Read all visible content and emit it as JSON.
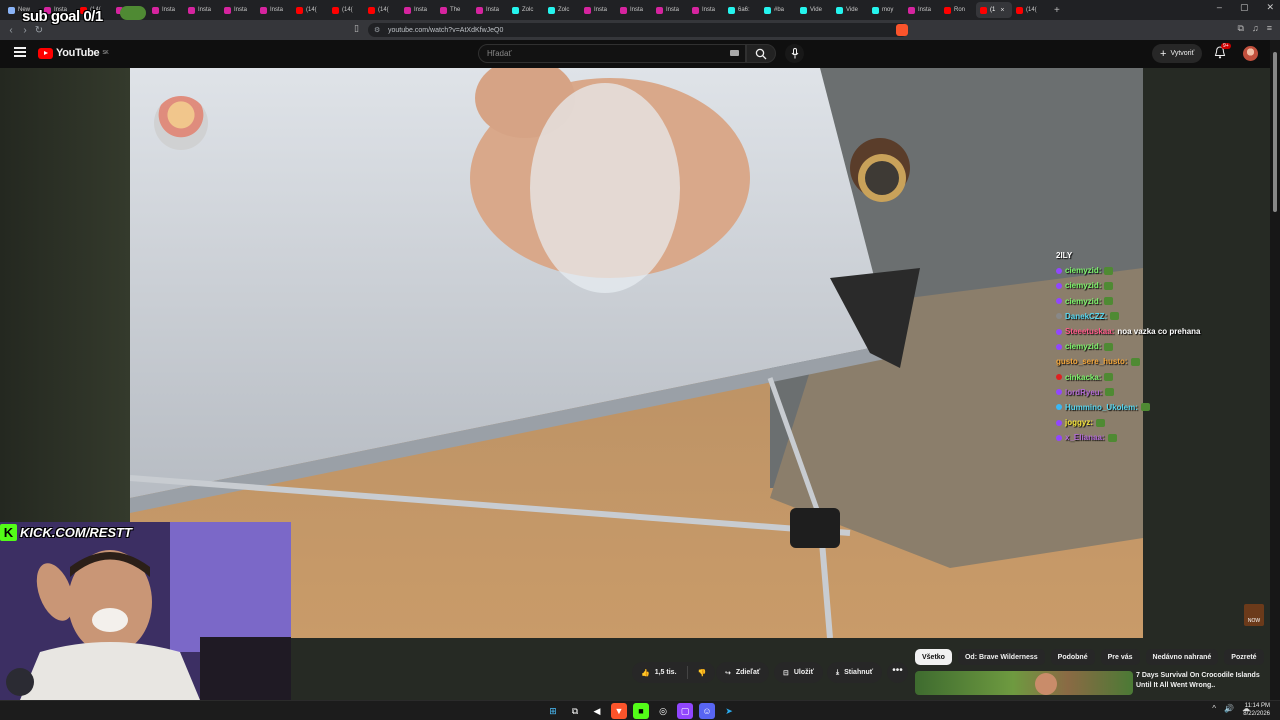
{
  "browser": {
    "tabs": [
      {
        "label": "New",
        "color": "#8ab4f8"
      },
      {
        "label": "Insta",
        "color": "#d6249f"
      },
      {
        "label": "(14(",
        "color": "#ff0000"
      },
      {
        "label": "Insta",
        "color": "#d6249f"
      },
      {
        "label": "Insta",
        "color": "#d6249f"
      },
      {
        "label": "Insta",
        "color": "#d6249f"
      },
      {
        "label": "Insta",
        "color": "#d6249f"
      },
      {
        "label": "Insta",
        "color": "#d6249f"
      },
      {
        "label": "(14(",
        "color": "#ff0000"
      },
      {
        "label": "(14(",
        "color": "#ff0000"
      },
      {
        "label": "(14(",
        "color": "#ff0000"
      },
      {
        "label": "Insta",
        "color": "#d6249f"
      },
      {
        "label": "The",
        "color": "#d6249f"
      },
      {
        "label": "Insta",
        "color": "#d6249f"
      },
      {
        "label": "Zolc",
        "color": "#25f4ee"
      },
      {
        "label": "Zolc",
        "color": "#25f4ee"
      },
      {
        "label": "Insta",
        "color": "#d6249f"
      },
      {
        "label": "Insta",
        "color": "#d6249f"
      },
      {
        "label": "Insta",
        "color": "#d6249f"
      },
      {
        "label": "Insta",
        "color": "#d6249f"
      },
      {
        "label": "6a6:",
        "color": "#25f4ee"
      },
      {
        "label": "#ba",
        "color": "#25f4ee"
      },
      {
        "label": "Vide",
        "color": "#25f4ee"
      },
      {
        "label": "Vide",
        "color": "#25f4ee"
      },
      {
        "label": "moy",
        "color": "#25f4ee"
      },
      {
        "label": "Insta",
        "color": "#d6249f"
      },
      {
        "label": "Ron",
        "color": "#ff0000"
      },
      {
        "label": "(1",
        "color": "#ff0000",
        "active": true
      },
      {
        "label": "(14(",
        "color": "#ff0000"
      }
    ],
    "new_tab_label": "+",
    "window_controls": [
      "–",
      "▢",
      "✕"
    ],
    "url": "youtube.com/watch?v=AtXdKfwJeQ0"
  },
  "youtube": {
    "logo_text": "YouTube",
    "region": "SK",
    "search_placeholder": "Hľadať",
    "create_label": "Vytvoriť",
    "notification_count": "9+",
    "actions": {
      "likes": "1,5 tis.",
      "share": "Zdieľať",
      "save": "Uložiť",
      "download": "Stiahnuť",
      "more": "•••"
    },
    "chips": [
      {
        "label": "Všetko",
        "active": true
      },
      {
        "label": "Od: Brave Wilderness",
        "active": false
      },
      {
        "label": "Podobné",
        "active": false
      },
      {
        "label": "Pre vás",
        "active": false
      },
      {
        "label": "Nedávno nahrané",
        "active": false
      },
      {
        "label": "Pozreté",
        "active": false
      }
    ],
    "recommendation_title": "7 Days Survival On Crocodile Islands Until It All Went Wrong.."
  },
  "overlay": {
    "sub_goal": "sub goal 0/1",
    "kick_channel": "KICK.COM/RESTT",
    "kick_letter": "K",
    "now_badge": "NOW",
    "chat_header": "2ILY",
    "chat": [
      {
        "user": "ciemyzid:",
        "color": "#7cf36b",
        "badge": "#9146ff",
        "msg": "",
        "emote": true
      },
      {
        "user": "ciemyzid:",
        "color": "#7cf36b",
        "badge": "#9146ff",
        "msg": "",
        "emote": true
      },
      {
        "user": "ciemyzid:",
        "color": "#7cf36b",
        "badge": "#9146ff",
        "msg": "",
        "emote": true
      },
      {
        "user": "DanekCZZ:",
        "color": "#58d7f0",
        "badge": "#888888",
        "msg": "",
        "emote": true
      },
      {
        "user": "Steeetuskaa:",
        "color": "#ff5b8a",
        "badge": "#9146ff",
        "msg": "noa vazka co prehana",
        "emote": false
      },
      {
        "user": "ciemyzid:",
        "color": "#7cf36b",
        "badge": "#9146ff",
        "msg": "",
        "emote": true
      },
      {
        "user": "gusto_sere_husto:",
        "color": "#f3a63b",
        "badge": "",
        "msg": "",
        "emote": true
      },
      {
        "user": "cinkacka:",
        "color": "#7cf36b",
        "badge": "#e02020",
        "msg": "",
        "emote": true
      },
      {
        "user": "lordRyeu:",
        "color": "#b36bd6",
        "badge": "#9146ff",
        "msg": "",
        "emote": true
      },
      {
        "user": "Hummino_Ukolem:",
        "color": "#58d7f0",
        "badge": "#3ab7f5",
        "msg": "",
        "emote": true
      },
      {
        "user": "joggyz:",
        "color": "#f3e33b",
        "badge": "#9146ff",
        "msg": "",
        "emote": true
      },
      {
        "user": "x_Elianaa:",
        "color": "#b36bd6",
        "badge": "#9146ff",
        "msg": "",
        "emote": true
      }
    ]
  },
  "taskbar": {
    "time": "11:14 PM",
    "date": "8/22/2026",
    "tray_icons": [
      "^",
      "🔊",
      "☁"
    ]
  }
}
